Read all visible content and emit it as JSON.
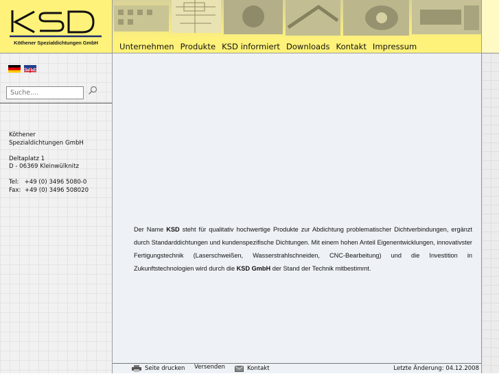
{
  "logo": {
    "mark": "KSD",
    "subtitle": "Köthener Spezialdichtungen GmbH"
  },
  "languages": [
    {
      "code": "de",
      "icon": "german-flag-icon"
    },
    {
      "code": "en",
      "icon": "uk-flag-icon"
    }
  ],
  "search": {
    "placeholder": "Suche....",
    "icon": "search-icon"
  },
  "address": {
    "company_line1": "Köthener",
    "company_line2": "Spezialdichtungen GmbH",
    "street": "Deltaplatz 1",
    "city": "D - 06369 Kleinwülknitz",
    "phone": "Tel:   +49 (0) 3496 5080-0",
    "fax": "Fax:  +49 (0) 3496 508020"
  },
  "nav": {
    "items": [
      "Unternehmen",
      "Produkte",
      "KSD informiert",
      "Downloads",
      "Kontakt",
      "Impressum"
    ]
  },
  "content": {
    "p1": "Der Name ",
    "b1": "KSD",
    "p2": " steht für qualitativ hochwertige Produkte zur Abdichtung problematischer Dichtverbindungen, ergänzt durch Standarddichtungen und kundenspezifische Dichtungen. Mit einem hohen Anteil Eigenentwicklungen, innovativster Fertigungstechnik (Laserschweißen, Wasserstrahlschneiden, CNC-Bearbeitung) und die Investition in Zukunftstechnologien wird durch die ",
    "b2": "KSD GmbH",
    "p3": " der Stand der Technik mitbestimmt."
  },
  "footer": {
    "print_label": "Seite drucken",
    "send_label": "Versenden",
    "contact_label": "Kontakt",
    "last_changed": "Letzte Änderung: 04.12.2008"
  },
  "colors": {
    "header_yellow": "#fff27a",
    "content_bg": "#eef2f6",
    "sidebar_bg": "#f1f1f1",
    "logo_blue": "#1c2a6e"
  }
}
